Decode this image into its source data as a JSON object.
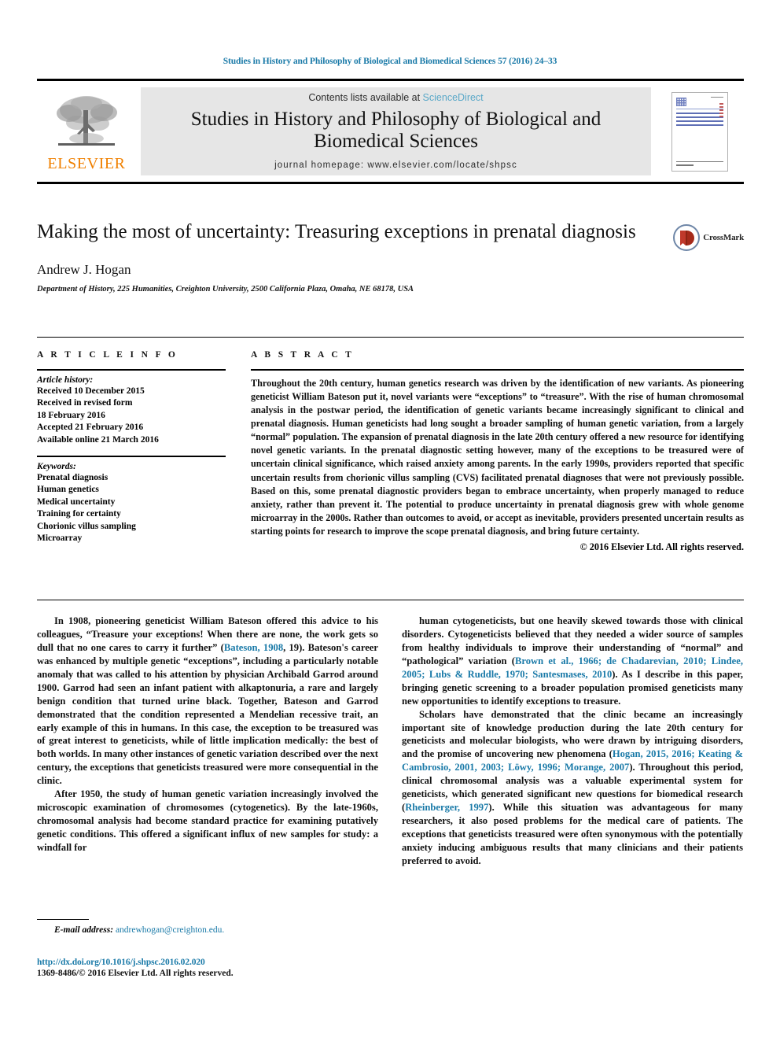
{
  "running_head": "Studies in History and Philosophy of Biological and Biomedical Sciences 57 (2016) 24–33",
  "colors": {
    "link": "#1a7aa8",
    "sciencedirect": "#5aa8c8",
    "elsevier_orange": "#f08000",
    "masthead_bg": "#e6e6e6"
  },
  "masthead": {
    "publisher_name": "ELSEVIER",
    "contents_prefix": "Contents lists available at ",
    "contents_link": "ScienceDirect",
    "journal_title": "Studies in History and Philosophy of Biological and Biomedical Sciences",
    "homepage": "journal homepage: www.elsevier.com/locate/shpsc",
    "cover_caption": "Studies in History and Philosophy of Biological and Biomedical Sciences"
  },
  "article": {
    "title": "Making the most of uncertainty: Treasuring exceptions in prenatal diagnosis",
    "author": "Andrew J. Hogan",
    "affiliation": "Department of History, 225 Humanities, Creighton University, 2500 California Plaza, Omaha, NE 68178, USA",
    "crossmark_label": "CrossMark"
  },
  "article_info": {
    "heading": "A R T I C L E   I N F O",
    "history_label": "Article history:",
    "history": [
      "Received 10 December 2015",
      "Received in revised form",
      "18 February 2016",
      "Accepted 21 February 2016",
      "Available online 21 March 2016"
    ],
    "keywords_label": "Keywords:",
    "keywords": [
      "Prenatal diagnosis",
      "Human genetics",
      "Medical uncertainty",
      "Training for certainty",
      "Chorionic villus sampling",
      "Microarray"
    ]
  },
  "abstract": {
    "heading": "A B S T R A C T",
    "text": "Throughout the 20th century, human genetics research was driven by the identification of new variants. As pioneering geneticist William Bateson put it, novel variants were “exceptions” to “treasure”. With the rise of human chromosomal analysis in the postwar period, the identification of genetic variants became increasingly significant to clinical and prenatal diagnosis. Human geneticists had long sought a broader sampling of human genetic variation, from a largely “normal” population. The expansion of prenatal diagnosis in the late 20th century offered a new resource for identifying novel genetic variants. In the prenatal diagnostic setting however, many of the exceptions to be treasured were of uncertain clinical significance, which raised anxiety among parents. In the early 1990s, providers reported that specific uncertain results from chorionic villus sampling (CVS) facilitated prenatal diagnoses that were not previously possible. Based on this, some prenatal diagnostic providers began to embrace uncertainty, when properly managed to reduce anxiety, rather than prevent it. The potential to produce uncertainty in prenatal diagnosis grew with whole genome microarray in the 2000s. Rather than outcomes to avoid, or accept as inevitable, providers presented uncertain results as starting points for research to improve the scope prenatal diagnosis, and bring future certainty.",
    "copyright": "© 2016 Elsevier Ltd. All rights reserved."
  },
  "body": {
    "left": {
      "p1_a": "In 1908, pioneering geneticist William Bateson offered this advice to his colleagues, “Treasure your exceptions! When there are none, the work gets so dull that no one cares to carry it further” (",
      "p1_ref1": "Bateson, 1908",
      "p1_b": ", 19). Bateson's career was enhanced by multiple genetic “exceptions”, including a particularly notable anomaly that was called to his attention by physician Archibald Garrod around 1900. Garrod had seen an infant patient with alkaptonuria, a rare and largely benign condition that turned urine black. Together, Bateson and Garrod demonstrated that the condition represented a Mendelian recessive trait, an early example of this in humans. In this case, the exception to be treasured was of great interest to geneticists, while of little implication medically: the best of both worlds. In many other instances of genetic variation described over the next century, the exceptions that geneticists treasured were more consequential in the clinic.",
      "p2": "After 1950, the study of human genetic variation increasingly involved the microscopic examination of chromosomes (cytogenetics). By the late-1960s, chromosomal analysis had become standard practice for examining putatively genetic conditions. This offered a significant influx of new samples for study: a windfall for"
    },
    "right": {
      "p1_a": "human cytogeneticists, but one heavily skewed towards those with clinical disorders. Cytogeneticists believed that they needed a wider source of samples from healthy individuals to improve their understanding of “normal” and “pathological” variation (",
      "p1_ref1": "Brown et al., 1966; de Chadarevian, 2010; Lindee, 2005; Lubs & Ruddle, 1970; Santesmases, 2010",
      "p1_b": "). As I describe in this paper, bringing genetic screening to a broader population promised geneticists many new opportunities to identify exceptions to treasure.",
      "p2_a": "Scholars have demonstrated that the clinic became an increasingly important site of knowledge production during the late 20th century for geneticists and molecular biologists, who were drawn by intriguing disorders, and the promise of uncovering new phenomena (",
      "p2_ref1": "Hogan, 2015, 2016; Keating & Cambrosio, 2001, 2003; Löwy, 1996; Morange, 2007",
      "p2_b": "). Throughout this period, clinical chromosomal analysis was a valuable experimental system for geneticists, which generated significant new questions for biomedical research (",
      "p2_ref2": "Rheinberger, 1997",
      "p2_c": "). While this situation was advantageous for many researchers, it also posed problems for the medical care of patients. The exceptions that geneticists treasured were often synonymous with the potentially anxiety inducing ambiguous results that many clinicians and their patients preferred to avoid."
    }
  },
  "footnote": {
    "label": "E-mail address:",
    "email": "andrewhogan@creighton.edu."
  },
  "page_footer": {
    "doi": "http://dx.doi.org/10.1016/j.shpsc.2016.02.020",
    "issn_line": "1369-8486/© 2016 Elsevier Ltd. All rights reserved."
  }
}
